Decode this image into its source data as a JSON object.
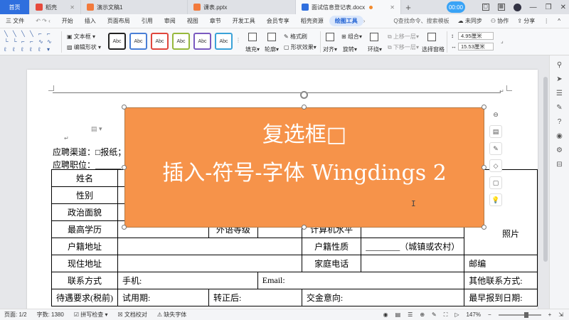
{
  "tabs": {
    "home": "首页",
    "items": [
      {
        "label": "稻壳",
        "color": "#e74a3c"
      },
      {
        "label": "演示文稿1",
        "color": "#f27a3c"
      },
      {
        "label": "课表.pptx",
        "color": "#f27a3c"
      },
      {
        "label": "面试信息登记表.docx",
        "color": "#2f6fde"
      }
    ],
    "timer": "00:00"
  },
  "menu": {
    "file": "三 文件",
    "items": [
      "开始",
      "插入",
      "页面布局",
      "引用",
      "审阅",
      "视图",
      "章节",
      "开发工具",
      "会员专享",
      "稻壳资源"
    ],
    "selected": "绘图工具",
    "search": "Q查找命令、搜索模板",
    "unsynced": "未同步",
    "collab": "协作",
    "share": "分享"
  },
  "ribbon": {
    "textbox": "文本框",
    "edit_shape": "编辑形状",
    "style_label": "Abc",
    "fill": "填充",
    "outline": "轮廓",
    "format_brush": "格式刷",
    "shape_effect": "形状效果",
    "align": "对齐",
    "group": "组合",
    "rotate": "旋转",
    "wrap": "环绕",
    "bring_forward": "上移一层",
    "send_backward": "下移一层",
    "selection_pane": "选择窗格",
    "height": "4.95厘米",
    "width": "15.53厘米"
  },
  "colors": {
    "accent": "#2f6fde",
    "overlay": "#f6934a",
    "style_borders": [
      "#222222",
      "#4a7fd6",
      "#e0463c",
      "#96b83c",
      "#7a59c0",
      "#3aa2d8"
    ]
  },
  "document": {
    "channel_label": "应聘渠道：",
    "channel_option": "□报纸；",
    "position_label": "应聘职位：",
    "position_blank": "______",
    "table": {
      "name": "姓名",
      "gender": "性别",
      "politics": "政治面貌",
      "education": "最高学历",
      "foreign_lang": "外语等级",
      "computer": "计算机水平",
      "photo": "照片",
      "hukou_addr": "户籍地址",
      "hukou_type": "户籍性质",
      "hukou_hint": "________（城镇或农村）",
      "current_addr": "现住地址",
      "home_phone": "家庭电话",
      "postcode": "邮编",
      "contact": "联系方式",
      "mobile": "手机:",
      "email": "Email:",
      "other_contact": "其他联系方式:",
      "salary": "待遇要求(税前)",
      "probation": "试用期:",
      "regular": "转正后:",
      "social": "交金意向:",
      "start_date": "最早报到日期:"
    }
  },
  "overlay": {
    "line1": "复选框□",
    "line2": "插入-符号-字体 Wingdings 2"
  },
  "status": {
    "page": "页面: 1/2",
    "words": "字数: 1380",
    "spell": "拼写检查",
    "proof": "文档校对",
    "missing_font": "缺失字体",
    "zoom": "147%"
  }
}
